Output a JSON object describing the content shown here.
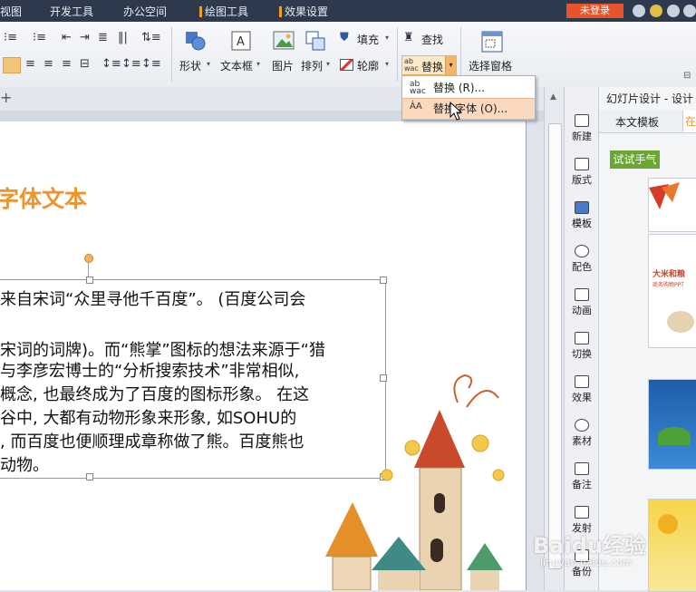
{
  "tabs": [
    "视图",
    "开发工具",
    "办公空间",
    "绘图工具",
    "效果设置"
  ],
  "login_label": "未登录",
  "ribbon": {
    "shape": "形状",
    "textbox": "文本框",
    "picture": "图片",
    "arrange": "排列",
    "fill": "填充",
    "outline": "轮廓",
    "find": "查找",
    "replace": "替换",
    "selection_pane": "选择窗格"
  },
  "dropdown": {
    "items": [
      {
        "label": "替换 (R)...",
        "icon": "ab-wac-replace-icon"
      },
      {
        "label": "替换字体 (O)...",
        "icon": "font-replace-icon"
      }
    ]
  },
  "slide": {
    "title": "字体文本",
    "lines": [
      "来自宋词“众里寻他千百度”。 (百度公司会",
      "",
      "宋词的词牌)。而“熊掌”图标的想法来源于“猎",
      "与李彦宏博士的“分析搜索技术”非常相似,",
      "概念, 也最终成为了百度的图标形象。 在这",
      "谷中, 大都有动物形象来形象, 如SOHU的",
      ", 而百度也便顺理成章称做了熊。百度熊也",
      "动物。"
    ]
  },
  "taskbar": [
    "新建",
    "版式",
    "模板",
    "配色",
    "动画",
    "切换",
    "效果",
    "素材",
    "备注",
    "发射",
    "备份"
  ],
  "panel": {
    "title": "幻灯片设计 - 设计",
    "tab_text_template": "本文模板",
    "tab_other": "在",
    "try_button": "试试手气",
    "thumb_text": "大米和粮",
    "thumb_sub": "商务购物PPT"
  },
  "watermark": {
    "logo": "Baidu经验",
    "url": "jingyan.baidu.com"
  },
  "colors": {
    "accent_orange": "#f0932b",
    "try_green": "#6aa632",
    "login_red": "#e8532b"
  }
}
